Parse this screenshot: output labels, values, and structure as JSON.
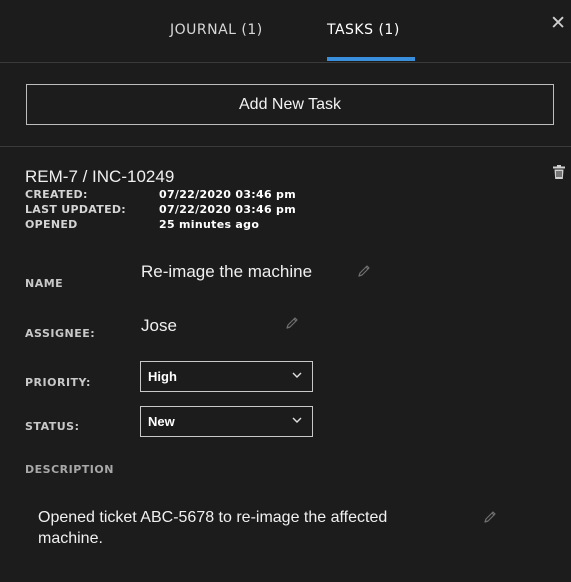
{
  "tabs": [
    {
      "label": "JOURNAL (1)",
      "active": false
    },
    {
      "label": "TASKS (1)",
      "active": true
    }
  ],
  "close_icon": "close-icon",
  "add_button_label": "Add New Task",
  "task": {
    "id": "REM-7 / INC-10249",
    "meta": [
      {
        "label": "CREATED:",
        "value": "07/22/2020 03:46 pm"
      },
      {
        "label": "LAST UPDATED:",
        "value": "07/22/2020 03:46 pm"
      },
      {
        "label": "OPENED",
        "value": "25 minutes ago"
      }
    ],
    "name_label": "NAME",
    "name_value": "Re-image the machine",
    "assignee_label": "ASSIGNEE:",
    "assignee_value": "Jose",
    "priority_label": "PRIORITY:",
    "priority_value": "High",
    "status_label": "STATUS:",
    "status_value": "New",
    "description_label": "DESCRIPTION",
    "description_value": "Opened ticket  ABC-5678 to re-image the affected machine."
  },
  "colors": {
    "background": "#1c1c1c",
    "accent": "#3a8fdc",
    "text": "#f0f0f0",
    "border": "#bdbdbd"
  },
  "icons": [
    "close-icon",
    "trash-icon",
    "pencil-icon",
    "chevron-down-icon"
  ]
}
